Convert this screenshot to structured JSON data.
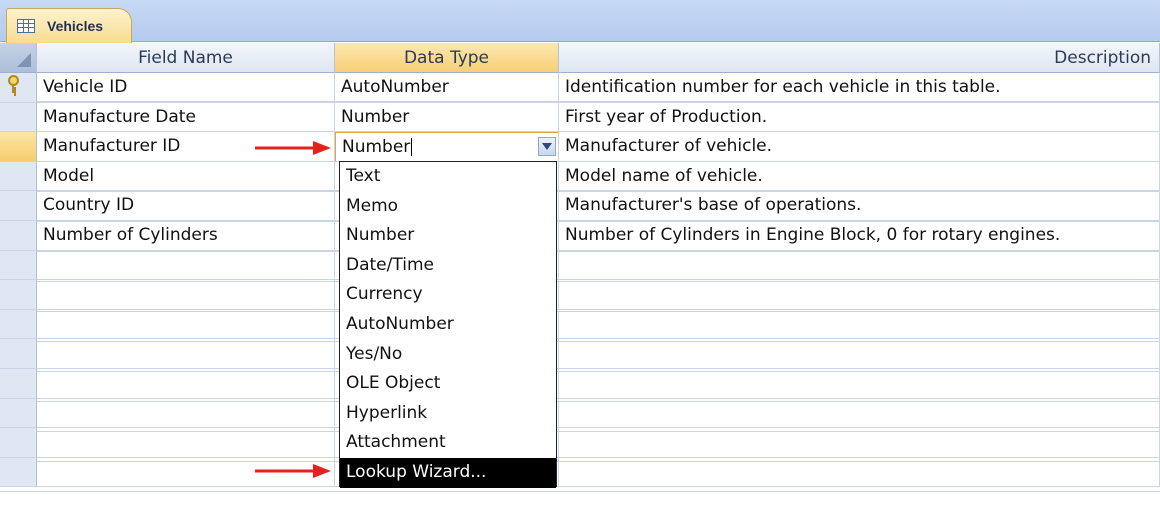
{
  "tab": {
    "label": "Vehicles",
    "icon": "table-icon"
  },
  "columns": {
    "field_name": "Field Name",
    "data_type": "Data Type",
    "description": "Description"
  },
  "rows": [
    {
      "field": "Vehicle ID",
      "type": "AutoNumber",
      "desc": "Identification number for each vehicle in this table.",
      "primary_key": true
    },
    {
      "field": "Manufacture Date",
      "type": "Number",
      "desc": "First year of Production."
    },
    {
      "field": "Manufacturer ID",
      "type": "Number",
      "desc": "Manufacturer of vehicle.",
      "current": true
    },
    {
      "field": "Model",
      "type": "",
      "desc": "Model name of vehicle."
    },
    {
      "field": "Country ID",
      "type": "",
      "desc": "Manufacturer's base of operations."
    },
    {
      "field": "Number of Cylinders",
      "type": "",
      "desc": "Number of Cylinders in Engine Block, 0 for rotary engines."
    }
  ],
  "editor": {
    "value": "Number"
  },
  "dropdown_options": [
    "Text",
    "Memo",
    "Number",
    "Date/Time",
    "Currency",
    "AutoNumber",
    "Yes/No",
    "OLE Object",
    "Hyperlink",
    "Attachment",
    "Lookup Wizard..."
  ],
  "highlighted_option": "Lookup Wizard...",
  "colors": {
    "arrow": "#e3231b",
    "accent_header": "#f7cf75",
    "grid_line": "#c9d4e5"
  }
}
